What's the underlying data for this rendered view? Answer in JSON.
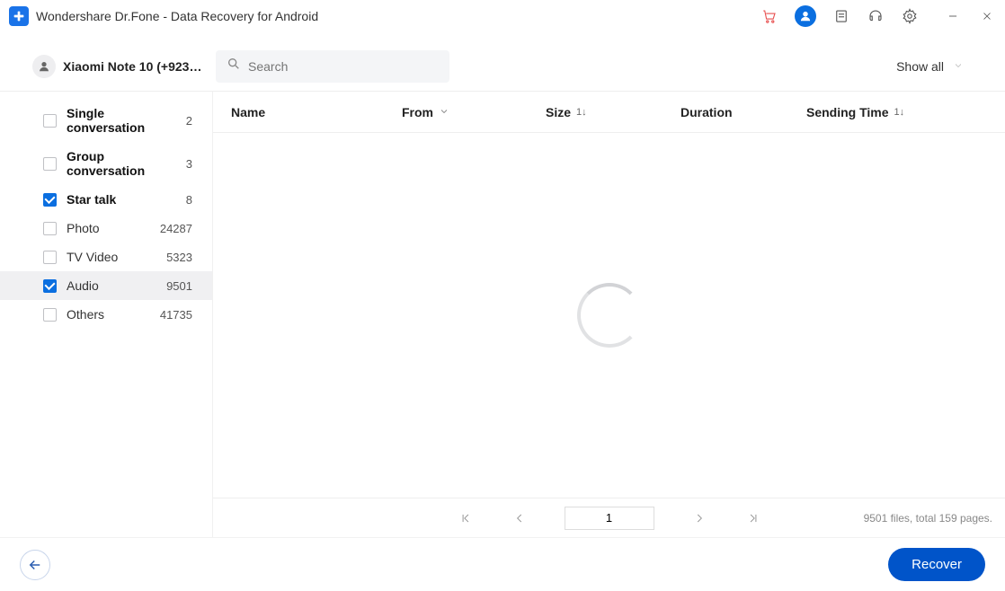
{
  "app": {
    "title": "Wondershare Dr.Fone - Data Recovery for Android"
  },
  "colors": {
    "primary": "#0b6fe0",
    "accent_red": "#e85050",
    "recover_btn": "#0054c9"
  },
  "toolbar": {
    "device_name": "Xiaomi  Note 10 (+92315...",
    "search_placeholder": "Search",
    "filter_label": "Show all"
  },
  "sidebar": {
    "items": [
      {
        "label": "Single conversation",
        "count": "2",
        "checked": false,
        "bold": true,
        "selected": false
      },
      {
        "label": "Group conversation",
        "count": "3",
        "checked": false,
        "bold": true,
        "selected": false
      },
      {
        "label": "Star talk",
        "count": "8",
        "checked": true,
        "bold": true,
        "selected": false
      },
      {
        "label": "Photo",
        "count": "24287",
        "checked": false,
        "bold": false,
        "selected": false
      },
      {
        "label": "TV Video",
        "count": "5323",
        "checked": false,
        "bold": false,
        "selected": false
      },
      {
        "label": "Audio",
        "count": "9501",
        "checked": true,
        "bold": false,
        "selected": true
      },
      {
        "label": "Others",
        "count": "41735",
        "checked": false,
        "bold": false,
        "selected": false
      }
    ]
  },
  "table": {
    "columns": {
      "name": "Name",
      "from": "From",
      "size": "Size",
      "duration": "Duration",
      "sending_time": "Sending Time"
    },
    "sort_glyph": "1↓"
  },
  "pagination": {
    "current_page": "1",
    "summary": "9501 files, total 159 pages."
  },
  "actions": {
    "recover": "Recover"
  }
}
